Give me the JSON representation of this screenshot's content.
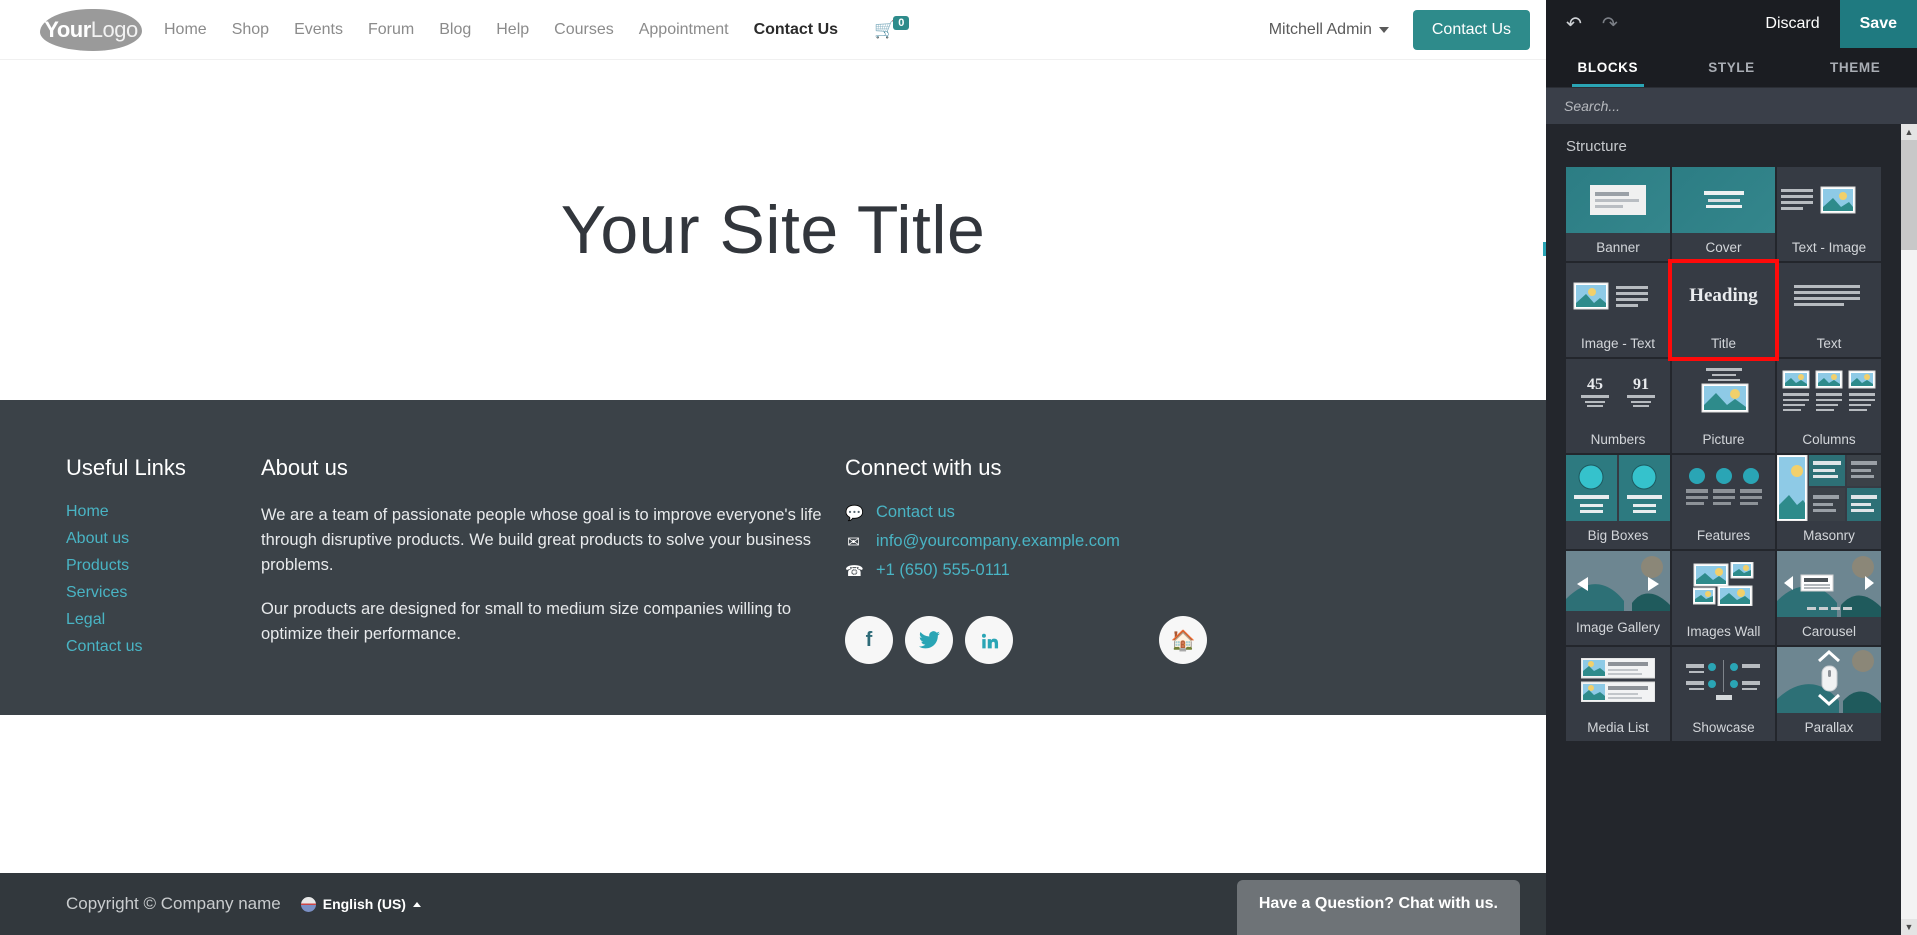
{
  "site": {
    "logo": {
      "bold": "Your",
      "light": "Logo"
    },
    "nav": [
      {
        "label": "Home",
        "active": false
      },
      {
        "label": "Shop",
        "active": false
      },
      {
        "label": "Events",
        "active": false
      },
      {
        "label": "Forum",
        "active": false
      },
      {
        "label": "Blog",
        "active": false
      },
      {
        "label": "Help",
        "active": false
      },
      {
        "label": "Courses",
        "active": false
      },
      {
        "label": "Appointment",
        "active": false
      },
      {
        "label": "Contact Us",
        "active": true
      }
    ],
    "cart_count": "0",
    "user": "Mitchell Admin",
    "cta_button": "Contact Us",
    "hero_title": "Your Site Title",
    "footer": {
      "links_title": "Useful Links",
      "links": [
        "Home",
        "About us",
        "Products",
        "Services",
        "Legal",
        "Contact us"
      ],
      "about_title": "About us",
      "about_p1": "We are a team of passionate people whose goal is to improve everyone's life through disruptive products. We build great products to solve your business problems.",
      "about_p2": "Our products are designed for small to medium size companies willing to optimize their performance.",
      "connect_title": "Connect with us",
      "contact_link": "Contact us",
      "email": "info@yourcompany.example.com",
      "phone": "+1 (650) 555-0111",
      "socials": [
        "facebook-icon",
        "twitter-icon",
        "linkedin-icon"
      ],
      "home_icon": "home-icon"
    },
    "copyright": "Copyright © Company name",
    "language": "English (US)",
    "chat_prompt": "Have a Question? Chat with us."
  },
  "editor": {
    "undo_icon": "undo-icon",
    "redo_icon": "redo-icon",
    "discard": "Discard",
    "save": "Save",
    "tabs": [
      {
        "label": "BLOCKS",
        "active": true
      },
      {
        "label": "STYLE",
        "active": false
      },
      {
        "label": "THEME",
        "active": false
      }
    ],
    "search_placeholder": "Search...",
    "section_title": "Structure",
    "accent": "#2aa5b5",
    "save_bg": "#1f7a80",
    "selected_block": "Title",
    "selection_color": "#ff0a0a",
    "blocks": [
      {
        "label": "Banner",
        "thumb": "banner"
      },
      {
        "label": "Cover",
        "thumb": "cover"
      },
      {
        "label": "Text - Image",
        "thumb": "text-image"
      },
      {
        "label": "Image - Text",
        "thumb": "image-text"
      },
      {
        "label": "Title",
        "thumb": "title",
        "thumb_text": "Heading",
        "selected": true
      },
      {
        "label": "Text",
        "thumb": "text"
      },
      {
        "label": "Numbers",
        "thumb": "numbers",
        "n1": "45",
        "n2": "91"
      },
      {
        "label": "Picture",
        "thumb": "picture"
      },
      {
        "label": "Columns",
        "thumb": "columns"
      },
      {
        "label": "Big Boxes",
        "thumb": "bigboxes"
      },
      {
        "label": "Features",
        "thumb": "features"
      },
      {
        "label": "Masonry",
        "thumb": "masonry"
      },
      {
        "label": "Image Gallery",
        "thumb": "gallery"
      },
      {
        "label": "Images Wall",
        "thumb": "imageswall"
      },
      {
        "label": "Carousel",
        "thumb": "carousel"
      },
      {
        "label": "Media List",
        "thumb": "medialist"
      },
      {
        "label": "Showcase",
        "thumb": "showcase"
      },
      {
        "label": "Parallax",
        "thumb": "parallax"
      }
    ]
  }
}
